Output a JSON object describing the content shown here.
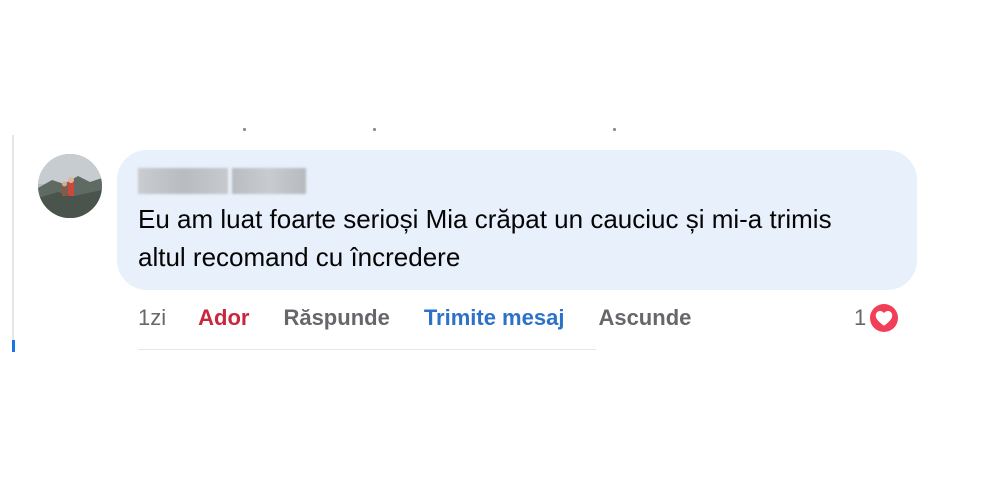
{
  "comment": {
    "author_name_redacted": true,
    "text": "Eu am luat foarte serioși Mia crăpat un cauciuc și mi-a trimis altul recomand cu încredere"
  },
  "actions": {
    "time": "1zi",
    "like_label": "Ador",
    "reply_label": "Răspunde",
    "message_label": "Trimite mesaj",
    "hide_label": "Ascunde"
  },
  "reactions": {
    "count": "1",
    "type_icon": "heart-icon",
    "color": "#f33e58"
  },
  "colors": {
    "bubble": "#e7f0fb",
    "like_active": "#c7283c",
    "message_link": "#2d72c9",
    "muted_text": "#65676b"
  }
}
